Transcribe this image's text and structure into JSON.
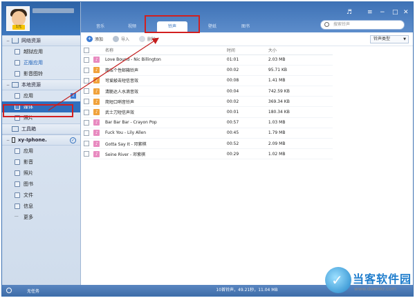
{
  "colors": {
    "brand_blue": "#2f6fbe",
    "highlight_red": "#d21f1f",
    "ringtone_icon": "#e88ac0",
    "ringtone_icon_alt": "#f0a23c"
  },
  "profile": {
    "badge": "1元"
  },
  "sidebar": {
    "sections": [
      {
        "title": "网络资源",
        "icon": "home-icon",
        "items": [
          {
            "label": "越狱应用",
            "icon": "apps-icon"
          },
          {
            "label": "正版应用",
            "icon": "apps-icon"
          },
          {
            "label": "影音图铃",
            "icon": "music-icon"
          }
        ]
      },
      {
        "title": "本地资源",
        "icon": "computer-icon",
        "items": [
          {
            "label": "应用",
            "icon": "apps-icon",
            "count": "2"
          },
          {
            "label": "媒体",
            "icon": "video-icon"
          },
          {
            "label": "照片",
            "icon": "photo-icon"
          }
        ]
      },
      {
        "title": "工具箱",
        "icon": "toolbox-icon",
        "items": []
      },
      {
        "title": "xy-Iphone.",
        "icon": "phone-icon",
        "items": [
          {
            "label": "应用",
            "icon": "apps-icon"
          },
          {
            "label": "影音",
            "icon": "video-icon"
          },
          {
            "label": "照片",
            "icon": "photo-icon"
          },
          {
            "label": "图书",
            "icon": "book-icon"
          },
          {
            "label": "文件",
            "icon": "file-icon"
          },
          {
            "label": "信息",
            "icon": "message-icon"
          },
          {
            "label": "更多",
            "icon": "more-icon"
          }
        ]
      }
    ],
    "footer_label": "无任务"
  },
  "tabs": [
    "音乐",
    "视频",
    "铃声",
    "壁纸",
    "图书"
  ],
  "active_tab": 2,
  "search": {
    "placeholder": "搜索铃声"
  },
  "toolbar": {
    "add_label": "添加",
    "import_label": "导入",
    "delete_label": "删除",
    "ringtone_type_label": "铃声类型"
  },
  "table": {
    "columns": [
      "名称",
      "时间",
      "大小"
    ],
    "rows": [
      {
        "name": "Love Bound - Nic Billington",
        "time": "01:01",
        "size": "2.03 MB"
      },
      {
        "name": "简洁个性邮箱铃声",
        "time": "00:02",
        "size": "95.71 KB"
      },
      {
        "name": "可爱敲击短信音效",
        "time": "00:08",
        "size": "1.41 MB"
      },
      {
        "name": "清脆达人水滴音效",
        "time": "00:04",
        "size": "742.59 KB"
      },
      {
        "name": "简短口哨音铃声",
        "time": "00:02",
        "size": "369.34 KB"
      },
      {
        "name": "武士刀短信声效",
        "time": "00:01",
        "size": "180.34 KB"
      },
      {
        "name": "Bar Bar Bar - Crayon Pop",
        "time": "00:57",
        "size": "1.03 MB"
      },
      {
        "name": "Fuck You - Lily Allen",
        "time": "00:45",
        "size": "1.79 MB"
      },
      {
        "name": "Gotta Say It - 邓紫棋",
        "time": "00:52",
        "size": "2.09 MB"
      },
      {
        "name": "Seine River - 邓紫棋",
        "time": "00:29",
        "size": "1.02 MB"
      }
    ]
  },
  "status": "10首铃声，49.21秒，11.04 MB",
  "watermark": {
    "text": "当客软件园",
    "url": "www.downkr.com"
  }
}
